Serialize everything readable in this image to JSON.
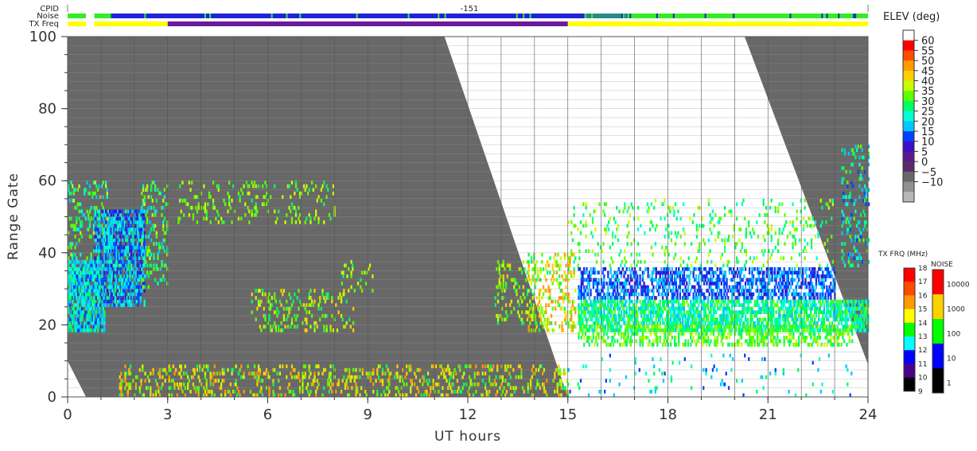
{
  "chart_data": {
    "type": "heatmap",
    "title": "",
    "xlabel": "UT hours",
    "ylabel": "Range Gate",
    "xlim": [
      0,
      24
    ],
    "ylim": [
      0,
      100
    ],
    "x_ticks": [
      "0",
      "3",
      "6",
      "9",
      "12",
      "15",
      "18",
      "21",
      "24"
    ],
    "y_ticks": [
      "0",
      "20",
      "40",
      "60",
      "80",
      "100"
    ],
    "status_rows": {
      "cpid_label": "CPID",
      "noise_label": "Noise",
      "txfreq_label": "TX Freq",
      "cpid_value": "-151",
      "noise_segments": [
        {
          "start": 0.0,
          "end": 0.55,
          "level": "100"
        },
        {
          "start": 0.8,
          "end": 1.3,
          "level": "100"
        },
        {
          "start": 1.3,
          "end": 15.5,
          "level": "10"
        },
        {
          "start": 15.5,
          "end": 16.8,
          "level": "10-100"
        },
        {
          "start": 16.8,
          "end": 24.0,
          "level": "100"
        }
      ],
      "txfreq_segments": [
        {
          "start": 0.0,
          "end": 0.55,
          "mhz": 14
        },
        {
          "start": 0.8,
          "end": 3.0,
          "mhz": 14
        },
        {
          "start": 3.0,
          "end": 15.0,
          "mhz": 11
        },
        {
          "start": 15.0,
          "end": 24.0,
          "mhz": 14
        }
      ]
    },
    "regions": [
      {
        "name": "ground scatter / no data (grey)",
        "value": -5,
        "boundary": "left wedge from (0,10)-(0.5,0) and diagonal (11.3,100)-(15,0); right wedge from (20.3,100)-(24,10)"
      },
      {
        "name": "night echoes",
        "x": [
          0,
          1.2
        ],
        "gates": [
          18,
          60
        ],
        "elev_range": [
          15,
          30
        ]
      },
      {
        "name": "dawn echoes",
        "x": [
          0.8,
          2.3
        ],
        "gates": [
          25,
          52
        ],
        "elev_range": [
          10,
          30
        ]
      },
      {
        "name": "mid-range patches",
        "x": [
          3.3,
          8.0
        ],
        "gates": [
          48,
          60
        ],
        "elev_range": [
          30,
          40
        ]
      },
      {
        "name": "low band",
        "x": [
          5.5,
          8.5
        ],
        "gates": [
          18,
          30
        ],
        "elev_range": [
          30,
          45
        ]
      },
      {
        "name": "near-range scatter",
        "x": [
          1.5,
          15.0
        ],
        "gates": [
          0,
          10
        ],
        "elev_range": [
          30,
          50
        ]
      },
      {
        "name": "afternoon band",
        "x": [
          15.3,
          23.0
        ],
        "gates": [
          15,
          36
        ],
        "elev_range": [
          10,
          40
        ]
      },
      {
        "name": "upper sparse echoes",
        "x": [
          15.0,
          23.0
        ],
        "gates": [
          36,
          55
        ],
        "elev_range": [
          20,
          40
        ]
      }
    ],
    "colorbars": [
      {
        "title": "ELEV (deg)",
        "labels": [
          "60",
          "55",
          "50",
          "45",
          "40",
          "35",
          "30",
          "25",
          "20",
          "15",
          "10",
          "5",
          "0",
          "−5",
          "−10"
        ],
        "colors": [
          "#ffffff",
          "#ff0000",
          "#ff4a00",
          "#ff9a00",
          "#ffd000",
          "#c8ff00",
          "#60ff00",
          "#00ff60",
          "#00ffd0",
          "#00c8ff",
          "#0040ff",
          "#3a10c8",
          "#5a1a8a",
          "#5a2a6a",
          "#686868",
          "#909090",
          "#b8b8b8"
        ]
      },
      {
        "title": "TX FRQ (MHz)",
        "labels": [
          "18",
          "17",
          "16",
          "15",
          "14",
          "13",
          "12",
          "11",
          "10",
          "9"
        ],
        "colors": [
          "#ff0000",
          "#ff4a00",
          "#ff9a00",
          "#ffff00",
          "#00ff00",
          "#00ffff",
          "#0000ff",
          "#4a0088",
          "#000000"
        ]
      },
      {
        "title": "NOISE",
        "labels": [
          "10000",
          "1000",
          "100",
          "10",
          "1"
        ],
        "colors": [
          "#ff0000",
          "#ffd000",
          "#00ff00",
          "#0000ff",
          "#000000"
        ]
      }
    ]
  }
}
